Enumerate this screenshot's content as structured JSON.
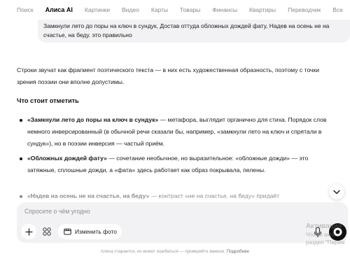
{
  "nav": {
    "items": [
      "Поиск",
      "Алиса AI",
      "Картинки",
      "Видео",
      "Карты",
      "Товары",
      "Финансы",
      "Квартиры",
      "Переводчик",
      "Все"
    ],
    "active_index": 1
  },
  "user_message": "Замкнули лето до поры на ключ в сундук, Достав оттуда обложных дождей фату, Надев на осень не на счастье, на беду. это правильно",
  "answer": {
    "intro": "Строки звучат как фрагмент поэтического текста — в них есть художественная образность, поэтому с точки зрения поэзии они вполне допустимы.",
    "section_title": "Что стоит отметить",
    "bullets": [
      {
        "bold": "«Замкнули лето до поры на ключ в сундук»",
        "text": " — метафора, выглядит органично для стиха. Порядок слов немного инверсированный (в обычной речи сказали бы, например, «замкнули лето на ключ и спрятали в сундук»), но в поэзии инверсия — частый приём."
      },
      {
        "bold": "«Обложных дождей фату»",
        "text": " — сочетание необычное, но выразительное: «обложные дожди» — это затяжные, сплошные дожди, а «фата» здесь работает как образ покрывала, пелены."
      },
      {
        "bold": "«Надев на осень не на счастье, на беду»",
        "text": " — контраст «не на счастье, на беду» придаёт"
      }
    ]
  },
  "input": {
    "placeholder": "Спросите о чём угодно",
    "value": ""
  },
  "toolbar": {
    "photo_label": "Изменить фото"
  },
  "watermark": {
    "line1": "Активация",
    "line2": "Чтобы акти",
    "line3": "раздел \"Парам"
  },
  "footer": {
    "text": "Алиса старается, но может ошибаться — проверяйте важное.",
    "link": "Подробнее"
  },
  "colors": {
    "bubble_bg": "#f2f2f4",
    "panel_bg": "#f2f2f4",
    "send_button": "#111111",
    "muted_text": "#8a8a8a"
  }
}
